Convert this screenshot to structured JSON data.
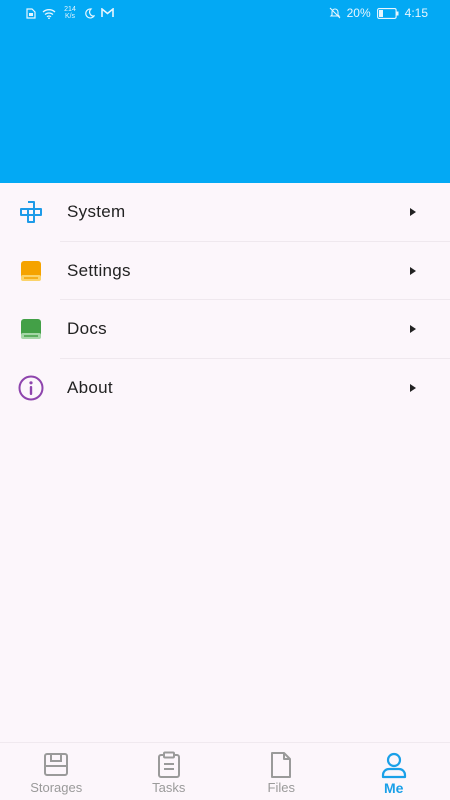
{
  "status_bar": {
    "net_speed_top": "214",
    "net_speed_bottom": "K/s",
    "battery": "20%",
    "time": "4:15",
    "icons": [
      "sim-icon",
      "wifi-icon",
      "moon-icon",
      "gmail-icon",
      "mute-icon",
      "battery-icon"
    ]
  },
  "colors": {
    "header": "#03a9f4",
    "accent": "#1aa0e8",
    "system_icon": "#1e9be8",
    "settings_icon": "#f5a300",
    "docs_icon": "#43a047",
    "about_icon": "#8e44ad"
  },
  "menu": {
    "items": [
      {
        "label": "System",
        "icon": "system-icon"
      },
      {
        "label": "Settings",
        "icon": "settings-book-icon"
      },
      {
        "label": "Docs",
        "icon": "docs-book-icon"
      },
      {
        "label": "About",
        "icon": "info-icon"
      }
    ]
  },
  "bottom_nav": {
    "items": [
      {
        "label": "Storages",
        "icon": "storage-icon"
      },
      {
        "label": "Tasks",
        "icon": "clipboard-icon"
      },
      {
        "label": "Files",
        "icon": "file-icon"
      },
      {
        "label": "Me",
        "icon": "person-icon",
        "active": true
      }
    ]
  }
}
